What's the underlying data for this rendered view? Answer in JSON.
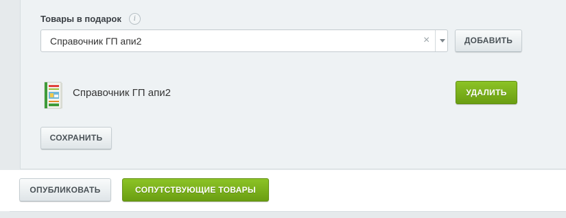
{
  "gifts": {
    "label": "Товары в подарок",
    "info_icon": "info-icon",
    "select": {
      "value": "Справочник ГП апи2",
      "clear_glyph": "×"
    },
    "add_label": "ДОБАВИТЬ",
    "items": [
      {
        "name": "Справочник ГП апи2",
        "remove_label": "УДАЛИТЬ"
      }
    ],
    "save_label": "СОХРАНИТЬ"
  },
  "footer": {
    "publish_label": "ОПУБЛИКОВАТЬ",
    "related_label": "СОПУТСТВУЮЩИЕ ТОВАРЫ"
  },
  "colors": {
    "accent_green": "#7ab31c",
    "panel_bg": "#eef2f4"
  }
}
